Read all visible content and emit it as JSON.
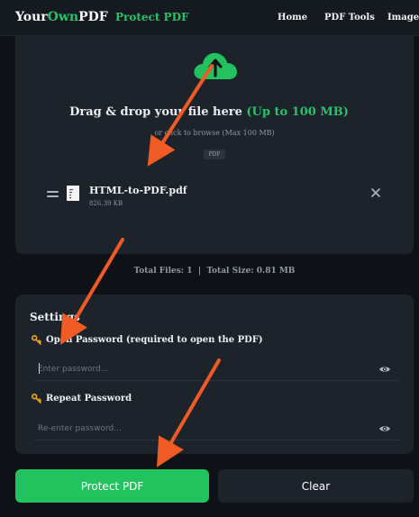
{
  "header": {
    "brand_part1": "Your",
    "brand_part2": "Own",
    "brand_part3": "PDF",
    "page_title": "Protect PDF",
    "nav": [
      "Home",
      "PDF Tools",
      "Image T"
    ]
  },
  "upload": {
    "drop_text": "Drag & drop your file here ",
    "drop_limit": "(Up to 100 MB)",
    "browse_text": "or click to browse (Max 100 MB)",
    "accepted_type": "PDF",
    "file": {
      "name": "HTML-to-PDF.pdf",
      "size": "826.39 KB"
    },
    "icons": {
      "upload": "cloud-upload-icon",
      "drag": "drag-handle-icon",
      "file": "file-icon",
      "remove": "close-icon"
    }
  },
  "totals": {
    "files_label": "Total Files: 1",
    "separator": "|",
    "size_label": "Total Size: 0.81 MB"
  },
  "settings": {
    "title": "Settings",
    "open_password_label": "Open Password (required to open the PDF)",
    "open_password_placeholder": "Enter password...",
    "open_password_value": "",
    "repeat_password_label": "Repeat Password",
    "repeat_password_placeholder": "Re-enter password...",
    "repeat_password_value": "",
    "icons": {
      "label": "key-icon",
      "toggle": "eye-icon"
    }
  },
  "actions": {
    "primary": "Protect PDF",
    "secondary": "Clear"
  },
  "colors": {
    "accent": "#27c267",
    "primary_button": "#22c35e",
    "card": "#1d232b",
    "background": "#0e1217",
    "annotation_arrow": "#f05a24",
    "key": "#f0a21c"
  }
}
